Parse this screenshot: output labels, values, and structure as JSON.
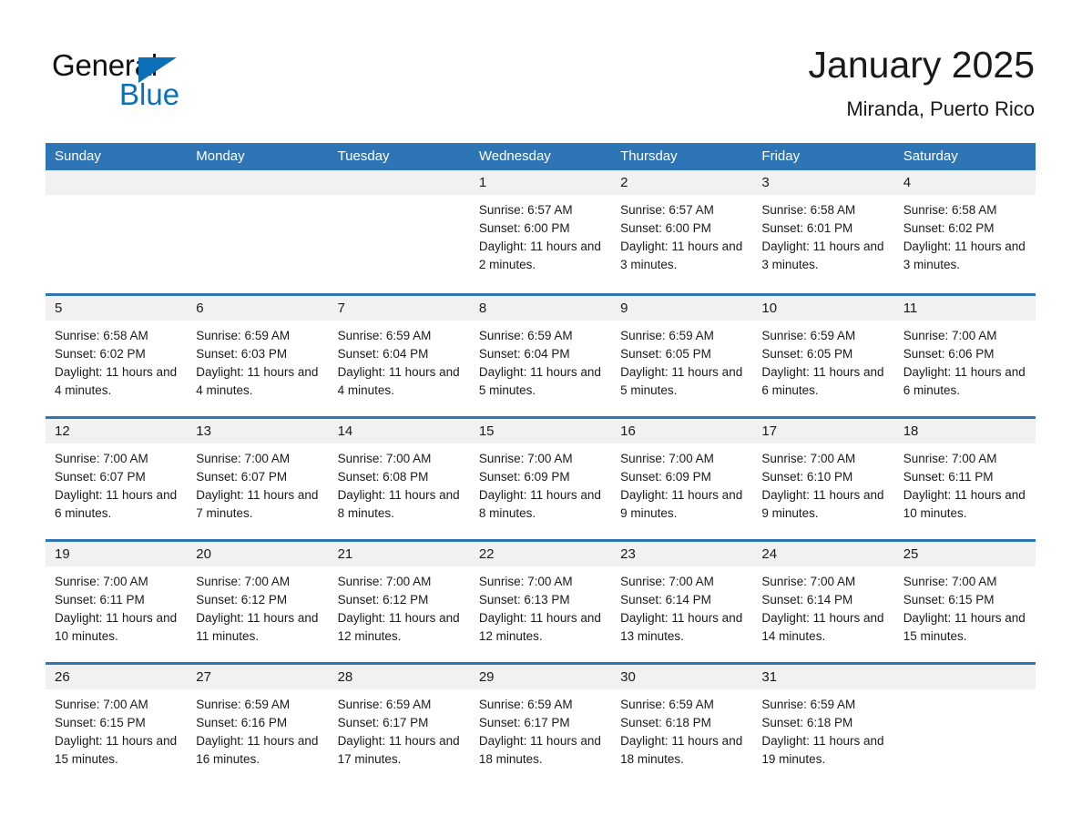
{
  "brand": {
    "logo_line1": "General",
    "logo_line2": "Blue",
    "accent_color": "#0c70b8"
  },
  "header": {
    "title": "January 2025",
    "subtitle": "Miranda, Puerto Rico"
  },
  "calendar": {
    "header_bg": "#2e75b6",
    "daynum_bg": "#f1f1f1",
    "weekdays": [
      "Sunday",
      "Monday",
      "Tuesday",
      "Wednesday",
      "Thursday",
      "Friday",
      "Saturday"
    ],
    "labels": {
      "sunrise_prefix": "Sunrise:",
      "sunset_prefix": "Sunset:",
      "daylight_prefix": "Daylight:"
    },
    "weeks": [
      [
        {
          "day": "",
          "sunrise": "",
          "sunset": "",
          "daylight": ""
        },
        {
          "day": "",
          "sunrise": "",
          "sunset": "",
          "daylight": ""
        },
        {
          "day": "",
          "sunrise": "",
          "sunset": "",
          "daylight": ""
        },
        {
          "day": "1",
          "sunrise": "Sunrise: 6:57 AM",
          "sunset": "Sunset: 6:00 PM",
          "daylight": "Daylight: 11 hours and 2 minutes."
        },
        {
          "day": "2",
          "sunrise": "Sunrise: 6:57 AM",
          "sunset": "Sunset: 6:00 PM",
          "daylight": "Daylight: 11 hours and 3 minutes."
        },
        {
          "day": "3",
          "sunrise": "Sunrise: 6:58 AM",
          "sunset": "Sunset: 6:01 PM",
          "daylight": "Daylight: 11 hours and 3 minutes."
        },
        {
          "day": "4",
          "sunrise": "Sunrise: 6:58 AM",
          "sunset": "Sunset: 6:02 PM",
          "daylight": "Daylight: 11 hours and 3 minutes."
        }
      ],
      [
        {
          "day": "5",
          "sunrise": "Sunrise: 6:58 AM",
          "sunset": "Sunset: 6:02 PM",
          "daylight": "Daylight: 11 hours and 4 minutes."
        },
        {
          "day": "6",
          "sunrise": "Sunrise: 6:59 AM",
          "sunset": "Sunset: 6:03 PM",
          "daylight": "Daylight: 11 hours and 4 minutes."
        },
        {
          "day": "7",
          "sunrise": "Sunrise: 6:59 AM",
          "sunset": "Sunset: 6:04 PM",
          "daylight": "Daylight: 11 hours and 4 minutes."
        },
        {
          "day": "8",
          "sunrise": "Sunrise: 6:59 AM",
          "sunset": "Sunset: 6:04 PM",
          "daylight": "Daylight: 11 hours and 5 minutes."
        },
        {
          "day": "9",
          "sunrise": "Sunrise: 6:59 AM",
          "sunset": "Sunset: 6:05 PM",
          "daylight": "Daylight: 11 hours and 5 minutes."
        },
        {
          "day": "10",
          "sunrise": "Sunrise: 6:59 AM",
          "sunset": "Sunset: 6:05 PM",
          "daylight": "Daylight: 11 hours and 6 minutes."
        },
        {
          "day": "11",
          "sunrise": "Sunrise: 7:00 AM",
          "sunset": "Sunset: 6:06 PM",
          "daylight": "Daylight: 11 hours and 6 minutes."
        }
      ],
      [
        {
          "day": "12",
          "sunrise": "Sunrise: 7:00 AM",
          "sunset": "Sunset: 6:07 PM",
          "daylight": "Daylight: 11 hours and 6 minutes."
        },
        {
          "day": "13",
          "sunrise": "Sunrise: 7:00 AM",
          "sunset": "Sunset: 6:07 PM",
          "daylight": "Daylight: 11 hours and 7 minutes."
        },
        {
          "day": "14",
          "sunrise": "Sunrise: 7:00 AM",
          "sunset": "Sunset: 6:08 PM",
          "daylight": "Daylight: 11 hours and 8 minutes."
        },
        {
          "day": "15",
          "sunrise": "Sunrise: 7:00 AM",
          "sunset": "Sunset: 6:09 PM",
          "daylight": "Daylight: 11 hours and 8 minutes."
        },
        {
          "day": "16",
          "sunrise": "Sunrise: 7:00 AM",
          "sunset": "Sunset: 6:09 PM",
          "daylight": "Daylight: 11 hours and 9 minutes."
        },
        {
          "day": "17",
          "sunrise": "Sunrise: 7:00 AM",
          "sunset": "Sunset: 6:10 PM",
          "daylight": "Daylight: 11 hours and 9 minutes."
        },
        {
          "day": "18",
          "sunrise": "Sunrise: 7:00 AM",
          "sunset": "Sunset: 6:11 PM",
          "daylight": "Daylight: 11 hours and 10 minutes."
        }
      ],
      [
        {
          "day": "19",
          "sunrise": "Sunrise: 7:00 AM",
          "sunset": "Sunset: 6:11 PM",
          "daylight": "Daylight: 11 hours and 10 minutes."
        },
        {
          "day": "20",
          "sunrise": "Sunrise: 7:00 AM",
          "sunset": "Sunset: 6:12 PM",
          "daylight": "Daylight: 11 hours and 11 minutes."
        },
        {
          "day": "21",
          "sunrise": "Sunrise: 7:00 AM",
          "sunset": "Sunset: 6:12 PM",
          "daylight": "Daylight: 11 hours and 12 minutes."
        },
        {
          "day": "22",
          "sunrise": "Sunrise: 7:00 AM",
          "sunset": "Sunset: 6:13 PM",
          "daylight": "Daylight: 11 hours and 12 minutes."
        },
        {
          "day": "23",
          "sunrise": "Sunrise: 7:00 AM",
          "sunset": "Sunset: 6:14 PM",
          "daylight": "Daylight: 11 hours and 13 minutes."
        },
        {
          "day": "24",
          "sunrise": "Sunrise: 7:00 AM",
          "sunset": "Sunset: 6:14 PM",
          "daylight": "Daylight: 11 hours and 14 minutes."
        },
        {
          "day": "25",
          "sunrise": "Sunrise: 7:00 AM",
          "sunset": "Sunset: 6:15 PM",
          "daylight": "Daylight: 11 hours and 15 minutes."
        }
      ],
      [
        {
          "day": "26",
          "sunrise": "Sunrise: 7:00 AM",
          "sunset": "Sunset: 6:15 PM",
          "daylight": "Daylight: 11 hours and 15 minutes."
        },
        {
          "day": "27",
          "sunrise": "Sunrise: 6:59 AM",
          "sunset": "Sunset: 6:16 PM",
          "daylight": "Daylight: 11 hours and 16 minutes."
        },
        {
          "day": "28",
          "sunrise": "Sunrise: 6:59 AM",
          "sunset": "Sunset: 6:17 PM",
          "daylight": "Daylight: 11 hours and 17 minutes."
        },
        {
          "day": "29",
          "sunrise": "Sunrise: 6:59 AM",
          "sunset": "Sunset: 6:17 PM",
          "daylight": "Daylight: 11 hours and 18 minutes."
        },
        {
          "day": "30",
          "sunrise": "Sunrise: 6:59 AM",
          "sunset": "Sunset: 6:18 PM",
          "daylight": "Daylight: 11 hours and 18 minutes."
        },
        {
          "day": "31",
          "sunrise": "Sunrise: 6:59 AM",
          "sunset": "Sunset: 6:18 PM",
          "daylight": "Daylight: 11 hours and 19 minutes."
        },
        {
          "day": "",
          "sunrise": "",
          "sunset": "",
          "daylight": ""
        }
      ]
    ]
  }
}
